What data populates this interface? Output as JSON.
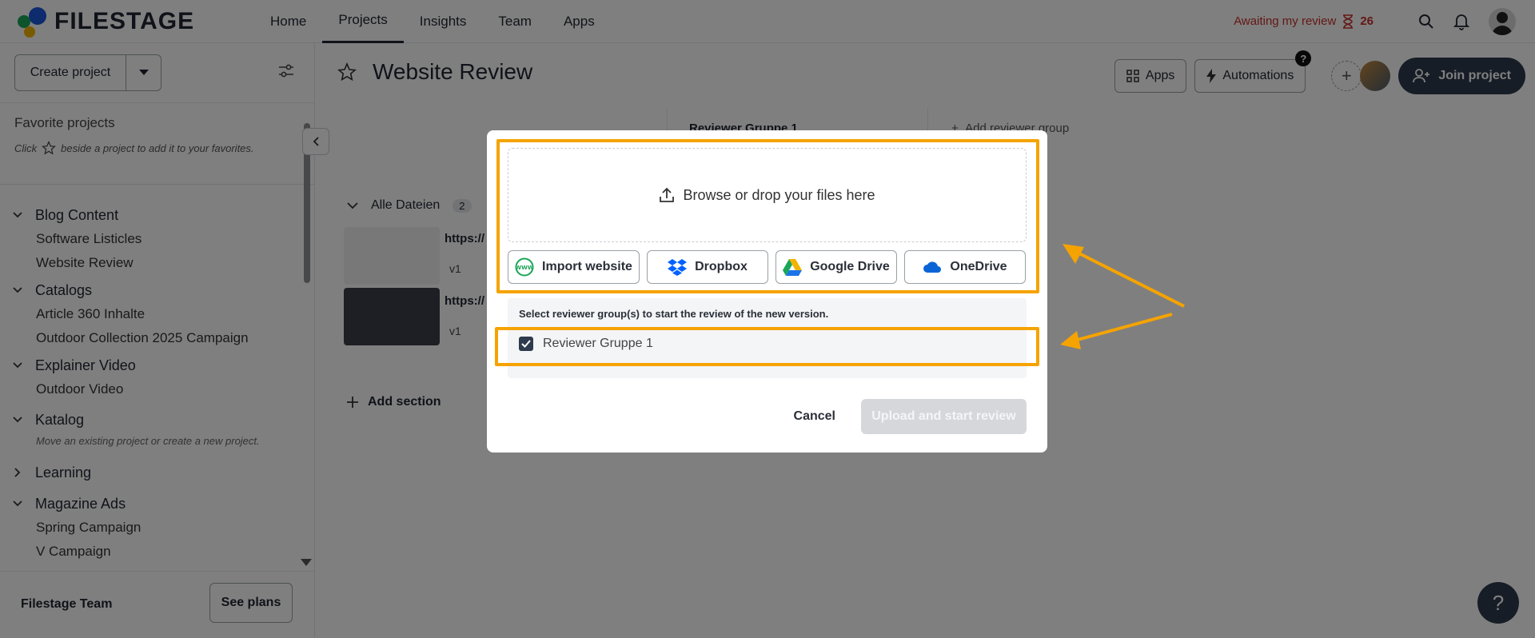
{
  "brand": {
    "name": "FILESTAGE"
  },
  "nav": {
    "items": [
      {
        "label": "Home"
      },
      {
        "label": "Projects"
      },
      {
        "label": "Insights"
      },
      {
        "label": "Team"
      },
      {
        "label": "Apps"
      }
    ]
  },
  "topbar": {
    "awaiting_label": "Awaiting my review",
    "awaiting_count": "26"
  },
  "sidebar": {
    "create_label": "Create project",
    "favorites_title": "Favorite projects",
    "favorites_hint_pre": "Click",
    "favorites_hint_post": "beside a project to add it to your favorites.",
    "groups": [
      {
        "name": "Blog Content",
        "projects": [
          "Software Listicles",
          "Website Review"
        ]
      },
      {
        "name": "Catalogs",
        "projects": [
          "Article 360 Inhalte",
          "Outdoor Collection 2025 Campaign"
        ]
      },
      {
        "name": "Explainer Video",
        "projects": [
          "Outdoor Video"
        ]
      },
      {
        "name": "Katalog",
        "hint": "Move an existing project or create a new project."
      },
      {
        "name": "Learning"
      },
      {
        "name": "Magazine Ads",
        "projects": [
          "Spring Campaign",
          "V Campaign"
        ]
      }
    ],
    "team_name": "Filestage Team",
    "see_plans": "See plans"
  },
  "main": {
    "title": "Website Review",
    "apps_label": "Apps",
    "automations_label": "Automations",
    "help_badge": "?",
    "join_label": "Join project",
    "column_header": "Reviewer Gruppe 1",
    "add_reviewer_group": "Add reviewer group",
    "section_name": "Alle Dateien",
    "section_count": "2",
    "files": [
      {
        "url": "https://",
        "version": "v1"
      },
      {
        "url": "https://",
        "version": "v1"
      }
    ],
    "add_section": "Add section",
    "help_fab": "?"
  },
  "modal": {
    "dropzone_text": "Browse or drop your files here",
    "sources": [
      {
        "label": "Import website",
        "icon": "www-globe-icon"
      },
      {
        "label": "Dropbox",
        "icon": "dropbox-icon"
      },
      {
        "label": "Google Drive",
        "icon": "google-drive-icon"
      },
      {
        "label": "OneDrive",
        "icon": "onedrive-icon"
      }
    ],
    "reviewer_hint": "Select reviewer group(s) to start the review of the new version.",
    "reviewer_group": "Reviewer Gruppe 1",
    "reviewer_checked": true,
    "cancel": "Cancel",
    "upload": "Upload and start review"
  },
  "colors": {
    "highlight": "#f5a300",
    "awaiting": "#c9302c",
    "primary_dark": "#2e3a4d"
  }
}
